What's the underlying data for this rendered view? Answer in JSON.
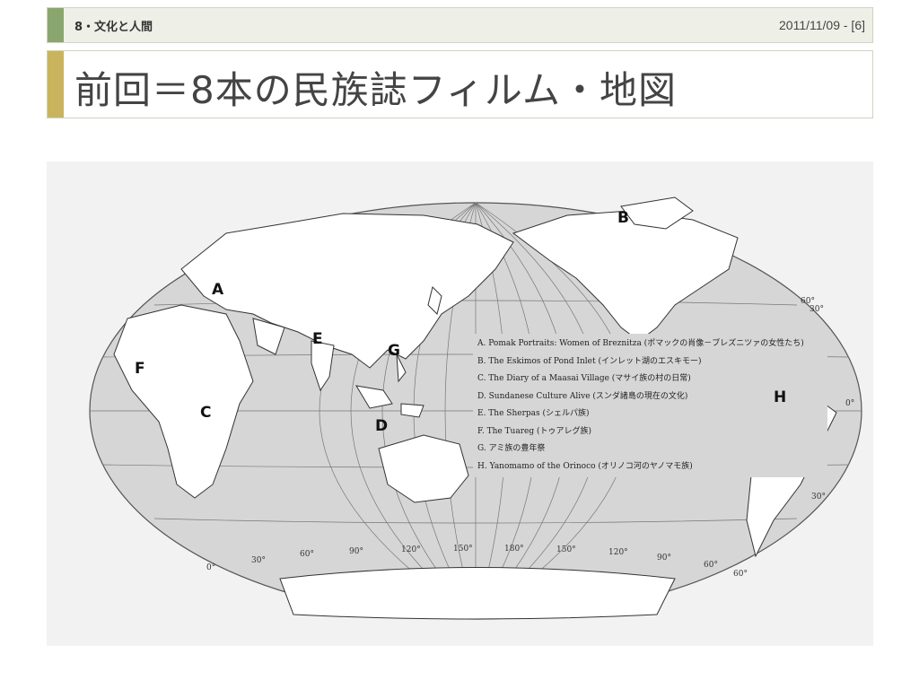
{
  "header": {
    "section": "8・文化と人間",
    "date_page": "2011/11/09 - [6]"
  },
  "slide": {
    "title": "前回＝8本の民族誌フィルム・地図"
  },
  "map": {
    "markers": [
      "A",
      "B",
      "C",
      "D",
      "E",
      "F",
      "G",
      "H"
    ],
    "legend": [
      "A. Pomak Portraits: Women of Breznitza (ポマックの肖像－ブレズニツァの女性たち)",
      "B. The Eskimos of Pond Inlet (インレット湖のエスキモー)",
      "C. The Diary of a Maasai Village (マサイ族の村の日常)",
      "D. Sundanese Culture Alive (スンダ諸島の現在の文化)",
      "E. The Sherpas (シェルパ族)",
      "F. The Tuareg (トゥアレグ族)",
      "G. アミ族の豊年祭",
      "H. Yanomamo of the Orinoco (オリノコ河のヤノマモ族)"
    ],
    "longitude_labels": [
      "0°",
      "30°",
      "60°",
      "90°",
      "120°",
      "150°",
      "180°",
      "150°",
      "120°",
      "90°",
      "60°"
    ],
    "latitude_labels": [
      "60°",
      "30°",
      "0°",
      "30°",
      "60°"
    ]
  }
}
